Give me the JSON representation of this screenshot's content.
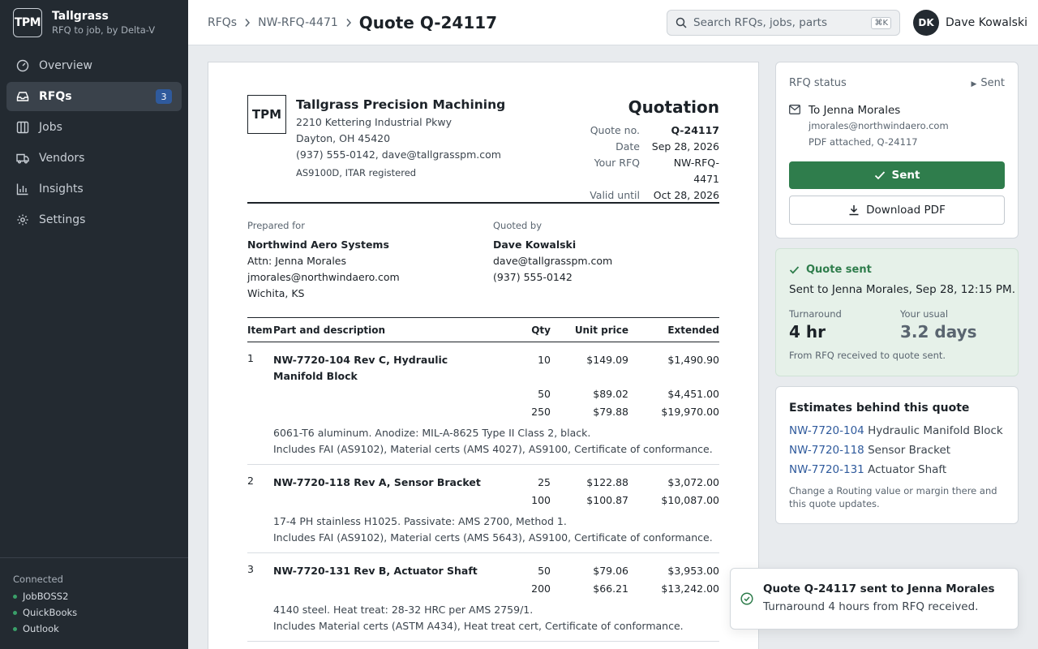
{
  "brand": {
    "logo": "TPM",
    "name": "Tallgrass",
    "tagline": "RFQ to job, by Delta-V"
  },
  "nav": {
    "items": [
      {
        "label": "Overview",
        "icon": "gauge-icon"
      },
      {
        "label": "RFQs",
        "icon": "inbox-icon",
        "badge": "3",
        "active": true
      },
      {
        "label": "Jobs",
        "icon": "columns-icon"
      },
      {
        "label": "Vendors",
        "icon": "truck-icon"
      },
      {
        "label": "Insights",
        "icon": "bar-chart-icon"
      },
      {
        "label": "Settings",
        "icon": "gear-icon"
      }
    ]
  },
  "connected": {
    "title": "Connected",
    "items": [
      "JobBOSS2",
      "QuickBooks",
      "Outlook"
    ],
    "status_color": "#3aa069"
  },
  "header": {
    "breadcrumbs": [
      "RFQs",
      "NW-RFQ-4471"
    ],
    "current": "Quote Q-24117",
    "search_placeholder": "Search RFQs, jobs, parts",
    "search_shortcut": "⌘K",
    "user_initials": "DK",
    "user_name": "Dave Kowalski"
  },
  "quote": {
    "company": {
      "logo": "TPM",
      "name": "Tallgrass Precision Machining",
      "address1": "2210 Kettering Industrial Pkwy",
      "address2": "Dayton, OH 45420",
      "contact": "(937) 555-0142, dave@tallgrasspm.com",
      "certs": "AS9100D, ITAR registered"
    },
    "title": "Quotation",
    "meta": [
      {
        "label": "Quote no.",
        "value": "Q-24117"
      },
      {
        "label": "Date",
        "value": "Sep 28, 2026"
      },
      {
        "label": "Your RFQ",
        "value": "NW-RFQ-4471"
      },
      {
        "label": "Valid until",
        "value": "Oct 28, 2026"
      }
    ],
    "prepared_for": {
      "label": "Prepared for",
      "name": "Northwind Aero Systems",
      "attn": "Attn: Jenna Morales",
      "email": "jmorales@northwindaero.com",
      "location": "Wichita, KS"
    },
    "quoted_by": {
      "label": "Quoted by",
      "name": "Dave Kowalski",
      "email": "dave@tallgrasspm.com",
      "phone": "(937) 555-0142"
    },
    "columns": {
      "item": "Item",
      "desc": "Part and description",
      "qty": "Qty",
      "unit": "Unit price",
      "ext": "Extended"
    },
    "items": [
      {
        "num": "1",
        "part": "NW-7720-104 Rev C, Hydraulic Manifold Block",
        "tiers": [
          {
            "qty": "10",
            "unit": "$149.09",
            "ext": "$1,490.90"
          },
          {
            "qty": "50",
            "unit": "$89.02",
            "ext": "$4,451.00"
          },
          {
            "qty": "250",
            "unit": "$79.88",
            "ext": "$19,970.00"
          }
        ],
        "notes": [
          "6061-T6 aluminum. Anodize: MIL-A-8625 Type II Class 2, black.",
          "Includes FAI (AS9102), Material certs (AMS 4027), AS9100, Certificate of conformance."
        ]
      },
      {
        "num": "2",
        "part": "NW-7720-118 Rev A, Sensor Bracket",
        "tiers": [
          {
            "qty": "25",
            "unit": "$122.88",
            "ext": "$3,072.00"
          },
          {
            "qty": "100",
            "unit": "$100.87",
            "ext": "$10,087.00"
          }
        ],
        "notes": [
          "17-4 PH stainless H1025. Passivate: AMS 2700, Method 1.",
          "Includes FAI (AS9102), Material certs (AMS 5643), AS9100, Certificate of conformance."
        ]
      },
      {
        "num": "3",
        "part": "NW-7720-131 Rev B, Actuator Shaft",
        "tiers": [
          {
            "qty": "50",
            "unit": "$79.06",
            "ext": "$3,953.00"
          },
          {
            "qty": "200",
            "unit": "$66.21",
            "ext": "$13,242.00"
          }
        ],
        "notes": [
          "4140 steel. Heat treat: 28-32 HRC per AMS 2759/1.",
          "Includes Material certs (ASTM A434), Heat treat cert, Certificate of conformance."
        ]
      }
    ]
  },
  "status_card": {
    "label": "RFQ status",
    "state": "Sent",
    "to": "To Jenna Morales",
    "email": "jmorales@northwindaero.com",
    "attachment": "PDF attached, Q-24117",
    "sent_button": "Sent",
    "download_button": "Download PDF",
    "accent": "#2f7d4c"
  },
  "sent_card": {
    "title": "Quote sent",
    "subtitle": "Sent to Jenna Morales, Sep 28, 12:15 PM.",
    "turnaround_label": "Turnaround",
    "turnaround_value": "4 hr",
    "usual_label": "Your usual",
    "usual_value": "3.2 days",
    "footnote": "From RFQ received to quote sent."
  },
  "estimates_card": {
    "title": "Estimates behind this quote",
    "items": [
      {
        "part": "NW-7720-104",
        "name": "Hydraulic Manifold Block"
      },
      {
        "part": "NW-7720-118",
        "name": "Sensor Bracket"
      },
      {
        "part": "NW-7720-131",
        "name": "Actuator Shaft"
      }
    ],
    "footnote": "Change a Routing value or margin there and this quote updates."
  },
  "toast": {
    "title": "Quote Q-24117 sent to Jenna Morales",
    "body": "Turnaround 4 hours from RFQ received."
  }
}
